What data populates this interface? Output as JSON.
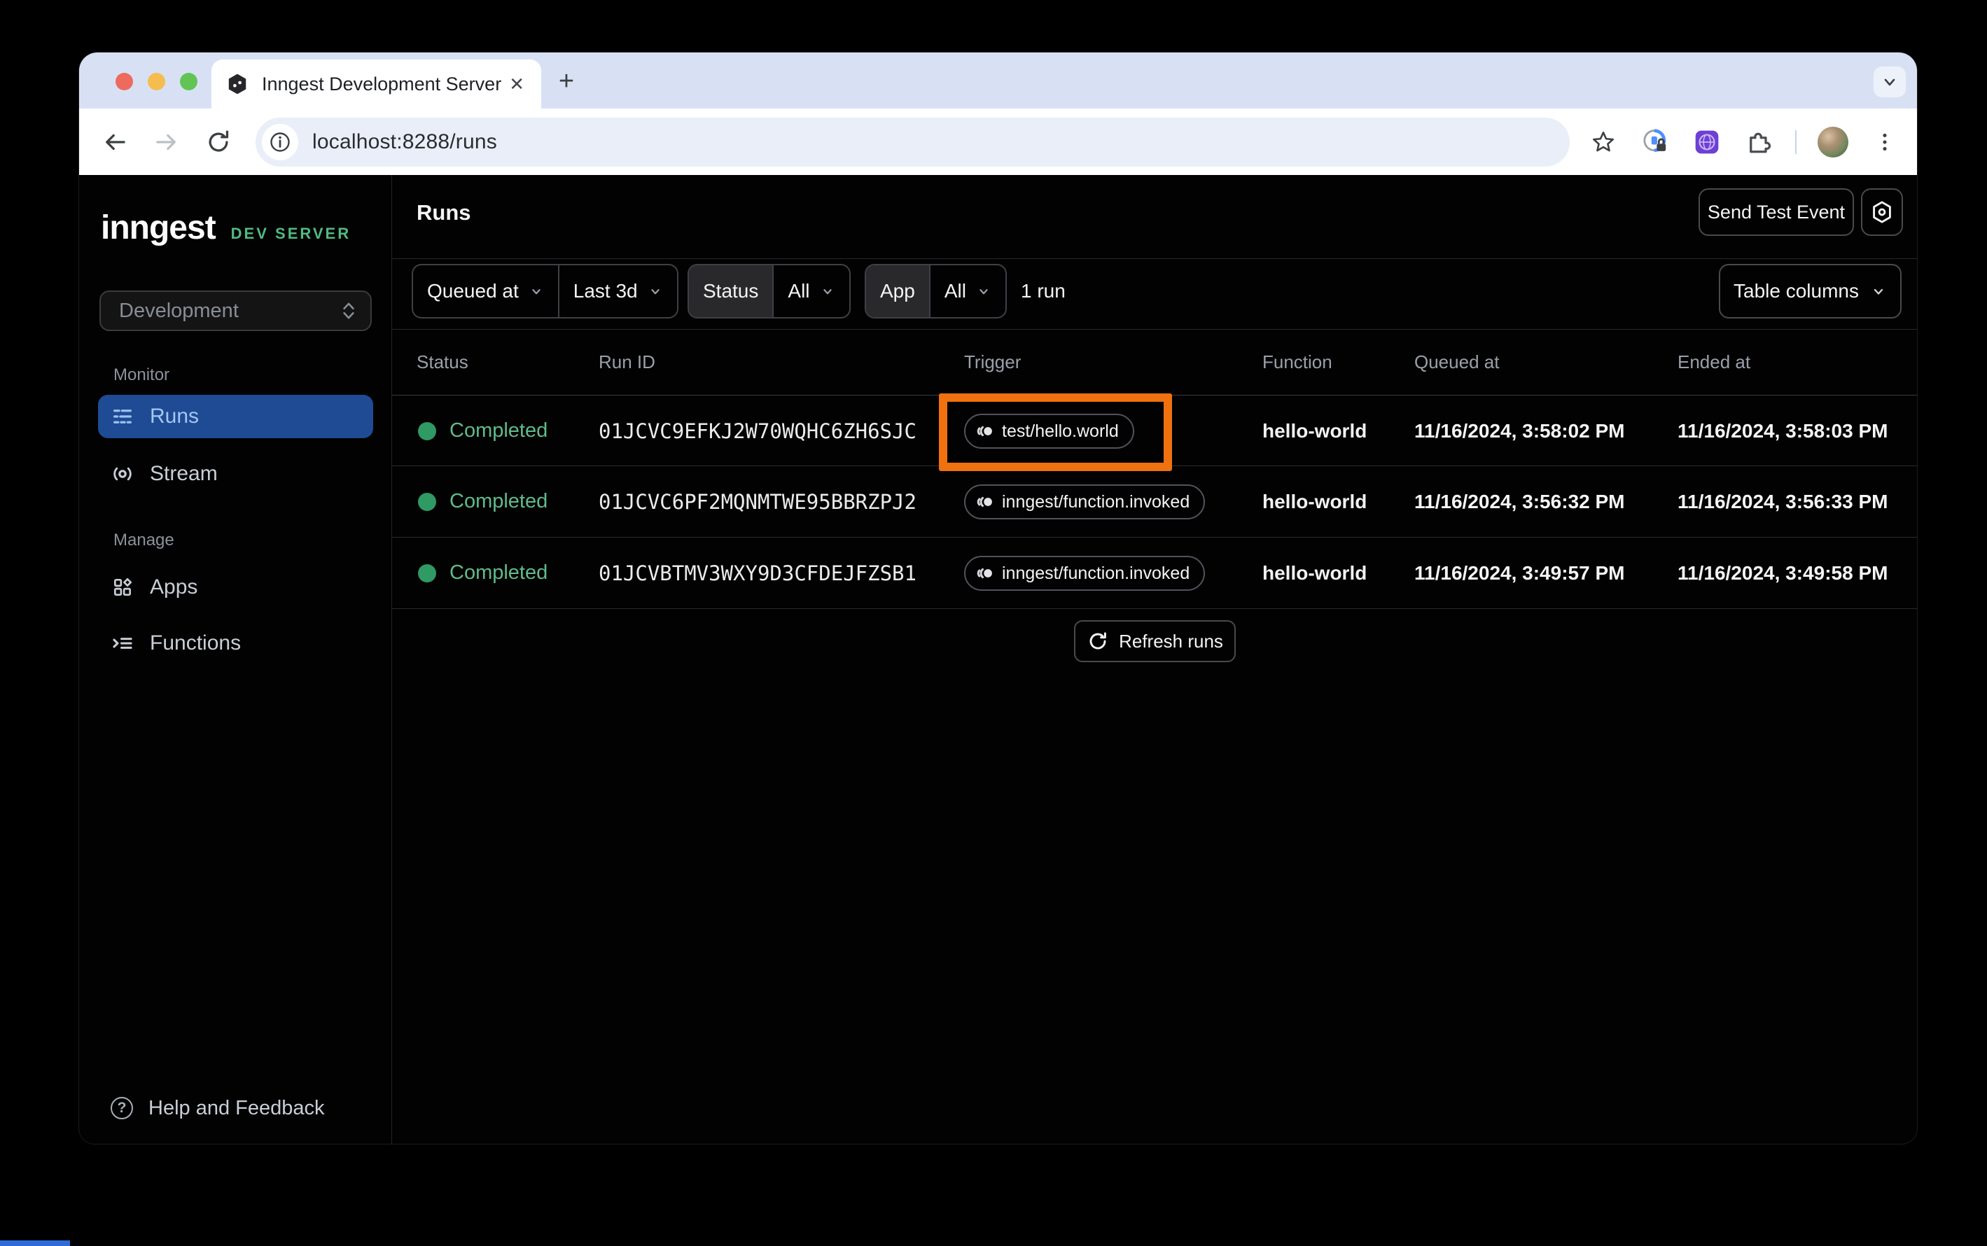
{
  "browser": {
    "tab_title": "Inngest Development Server",
    "url": "localhost:8288/runs"
  },
  "sidebar": {
    "logo_text": "inngest",
    "logo_badge": "DEV SERVER",
    "environment": "Development",
    "monitor_label": "Monitor",
    "runs_label": "Runs",
    "stream_label": "Stream",
    "manage_label": "Manage",
    "apps_label": "Apps",
    "functions_label": "Functions",
    "help_label": "Help and Feedback"
  },
  "main": {
    "title": "Runs",
    "send_test_event_label": "Send Test Event",
    "filters": {
      "queued_at_label": "Queued at",
      "time_range_value": "Last 3d",
      "status_label": "Status",
      "status_value": "All",
      "app_label": "App",
      "app_value": "All",
      "run_count": "1 run",
      "table_columns_label": "Table columns"
    },
    "table": {
      "columns": [
        "Status",
        "Run ID",
        "Trigger",
        "Function",
        "Queued at",
        "Ended at"
      ],
      "rows": [
        {
          "status": "Completed",
          "run_id": "01JCVC9EFKJ2W70WQHC6ZH6SJC",
          "trigger": "test/hello.world",
          "function": "hello-world",
          "queued_at": "11/16/2024, 3:58:02 PM",
          "ended_at": "11/16/2024, 3:58:03 PM",
          "highlighted": true
        },
        {
          "status": "Completed",
          "run_id": "01JCVC6PF2MQNMTWE95BBRZPJ2",
          "trigger": "inngest/function.invoked",
          "function": "hello-world",
          "queued_at": "11/16/2024, 3:56:32 PM",
          "ended_at": "11/16/2024, 3:56:33 PM",
          "highlighted": false
        },
        {
          "status": "Completed",
          "run_id": "01JCVBTMV3WXY9D3CFDEJFZSB1",
          "trigger": "inngest/function.invoked",
          "function": "hello-world",
          "queued_at": "11/16/2024, 3:49:57 PM",
          "ended_at": "11/16/2024, 3:49:58 PM",
          "highlighted": false
        }
      ],
      "refresh_label": "Refresh runs"
    }
  },
  "colors": {
    "highlight_orange": "#F0710F",
    "status_green": "#2F9A64",
    "active_blue": "#1E4B94",
    "brand_green": "#52BA81"
  }
}
